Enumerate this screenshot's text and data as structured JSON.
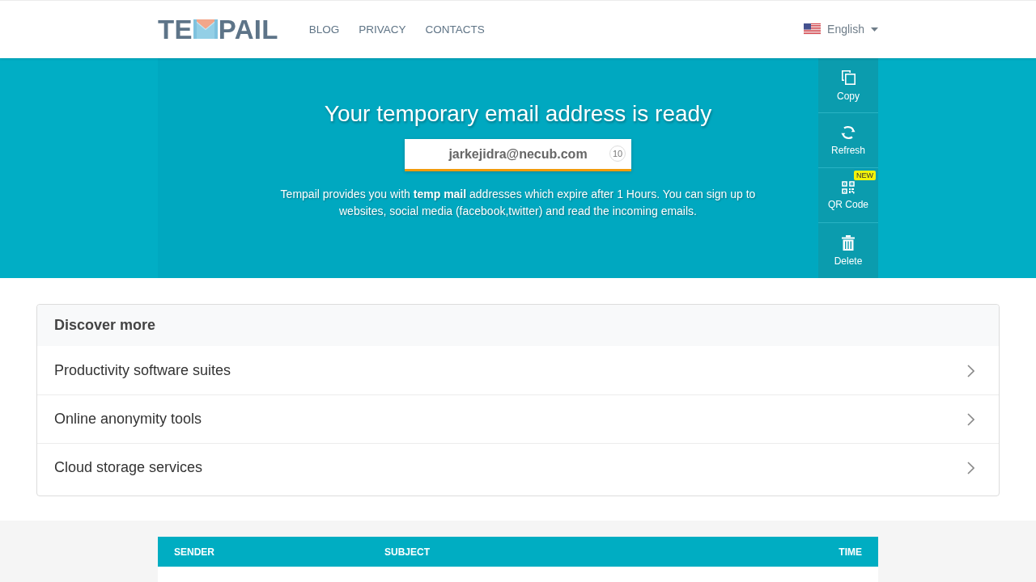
{
  "header": {
    "logo": {
      "text_start": "TE",
      "text_end": "PAIL"
    },
    "nav": [
      "BLOG",
      "PRIVACY",
      "CONTACTS"
    ],
    "language": {
      "label": "English"
    }
  },
  "hero": {
    "title": "Your temporary email address is ready",
    "email": {
      "value": "jarkejidra@necub.com",
      "counter": "10"
    },
    "description": "Tempail provides you with **temp mail** addresses which expire after 1 Hours. You can sign up to websites, social media (facebook,twitter) and read the incoming emails.",
    "actions": [
      {
        "kind": "copy",
        "label": "Copy"
      },
      {
        "kind": "refresh",
        "label": "Refresh"
      },
      {
        "kind": "qr",
        "label": "QR Code",
        "badge": "NEW"
      },
      {
        "kind": "delete",
        "label": "Delete"
      }
    ]
  },
  "discover": {
    "title": "Discover more",
    "items": [
      "Productivity software suites",
      "Online anonymity tools",
      "Cloud storage services"
    ]
  },
  "inbox": {
    "columns": [
      "SENDER",
      "SUBJECT",
      "TIME"
    ]
  }
}
